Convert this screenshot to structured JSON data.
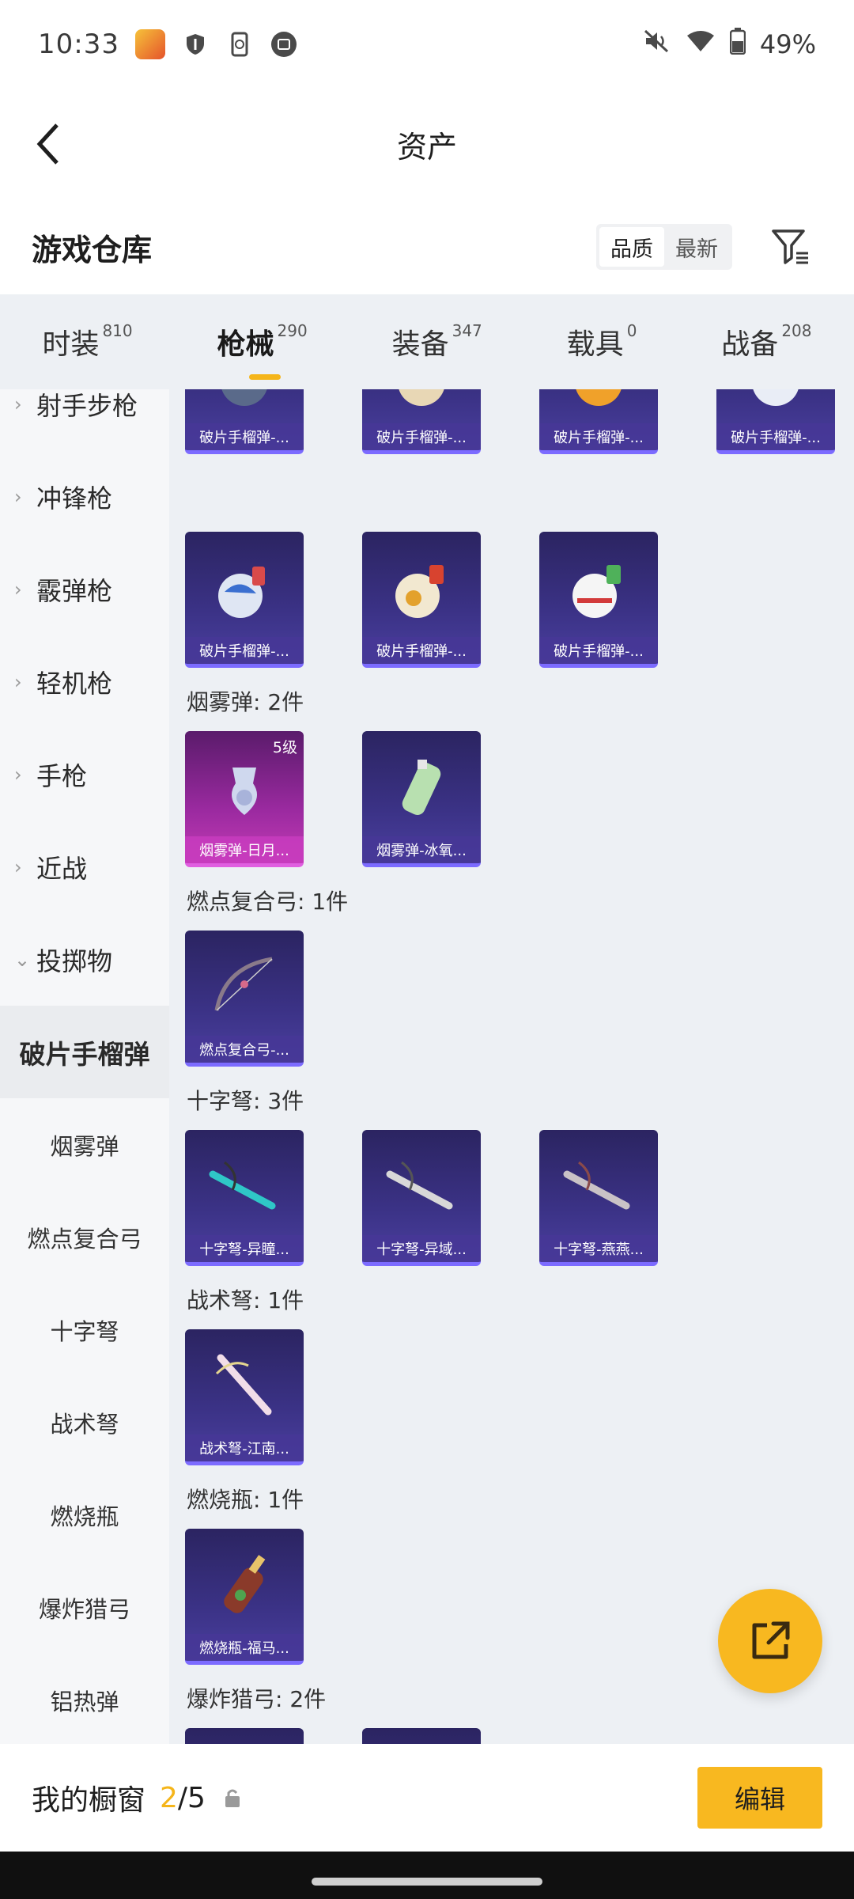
{
  "status_bar": {
    "time": "10:33",
    "battery": "49%"
  },
  "header": {
    "title": "资产"
  },
  "warehouse": {
    "title": "游戏仓库",
    "sort": [
      "品质",
      "最新"
    ]
  },
  "tabs": [
    {
      "label": "时装",
      "count": "810"
    },
    {
      "label": "枪械",
      "count": "290"
    },
    {
      "label": "装备",
      "count": "347"
    },
    {
      "label": "载具",
      "count": "0"
    },
    {
      "label": "战备",
      "count": "208"
    }
  ],
  "sidebar": {
    "items": [
      "射手步枪",
      "冲锋枪",
      "霰弹枪",
      "轻机枪",
      "手枪",
      "近战",
      "投掷物"
    ],
    "active": "破片手榴弹",
    "subitems": [
      "烟雾弹",
      "燃点复合弓",
      "十字弩",
      "战术弩",
      "燃烧瓶",
      "爆炸猎弓",
      "铝热弹"
    ]
  },
  "content": {
    "row1": [
      "破片手榴弹-...",
      "破片手榴弹-...",
      "破片手榴弹-...",
      "破片手榴弹-..."
    ],
    "row2": [
      "破片手榴弹-...",
      "破片手榴弹-...",
      "破片手榴弹-..."
    ],
    "smoke": {
      "label": "烟雾弹: 2件",
      "items": [
        "烟雾弹-日月...",
        "烟雾弹-冰氧..."
      ],
      "level": "5级"
    },
    "bow": {
      "label": "燃点复合弓: 1件",
      "items": [
        "燃点复合弓-..."
      ]
    },
    "crossbow": {
      "label": "十字弩: 3件",
      "items": [
        "十字弩-异瞳...",
        "十字弩-异域...",
        "十字弩-燕燕..."
      ]
    },
    "tactical": {
      "label": "战术弩: 1件",
      "items": [
        "战术弩-江南..."
      ]
    },
    "molotov": {
      "label": "燃烧瓶: 1件",
      "items": [
        "燃烧瓶-福马..."
      ]
    },
    "hunting": {
      "label": "爆炸猎弓: 2件"
    }
  },
  "bottom": {
    "showcase": "我的橱窗",
    "current": "2",
    "total": "/5",
    "edit": "编辑"
  },
  "colors": {
    "accent": "#f8b820",
    "card": "#3b3286"
  },
  "icons": [
    "back-arrow-icon",
    "filter-icon",
    "share-icon",
    "lock-icon",
    "mute-icon",
    "wifi-icon",
    "battery-icon",
    "shield-icon"
  ]
}
